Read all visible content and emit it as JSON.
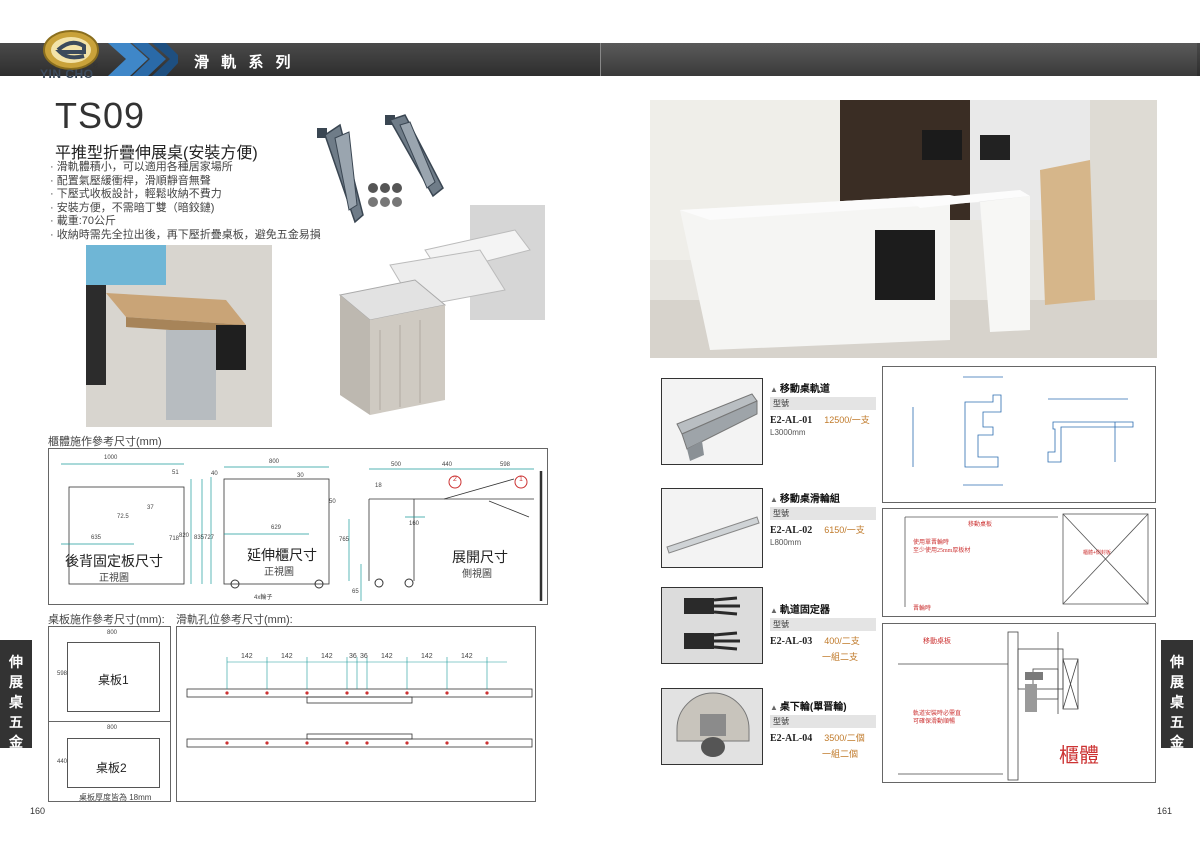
{
  "header": {
    "brand": "YIN CHO",
    "series": "滑 軌 系 列"
  },
  "product": {
    "model": "TS09",
    "title": "平推型折疊伸展桌(安裝方便)",
    "features": [
      "· 滑軌體積小，可以適用各種居家場所",
      "· 配置氣壓緩衝桿，滑順靜音無聲",
      "· 下壓式收板設計，輕鬆收納不費力",
      "· 安裝方便，不需暗丁雙（暗鉸鏈)",
      "· 載重:70公斤",
      "· 收納時需先全拉出後，再下壓折疊桌板，避免五金易損"
    ]
  },
  "sections": {
    "cabinet_dims": "櫃體施作參考尺寸(mm)",
    "board_dims": "桌板施作參考尺寸(mm):",
    "hole_dims": "滑軌孔位參考尺寸(mm):"
  },
  "drawing": {
    "back_board": "後背固定板尺寸",
    "back_view": "正視圖",
    "extend_cab": "延伸櫃尺寸",
    "extend_view": "正視圖",
    "unfold": "展開尺寸",
    "side_view": "側視圖",
    "dims": {
      "d1000": "1000",
      "d51": "51",
      "d37": "37",
      "d725": "72.5",
      "d635": "635",
      "d718": "718",
      "d820": "820",
      "d800": "800",
      "d30": "30",
      "d629": "629",
      "d40": "40",
      "d835": "835",
      "d727": "727",
      "d4x": "4x輪子",
      "d500": "500",
      "d440": "440",
      "d598": "598",
      "d18": "18",
      "d160": "160",
      "d765": "765",
      "d65": "65",
      "d50": "50",
      "c1": "1",
      "c2": "2"
    }
  },
  "boards": {
    "board1": "桌板1",
    "board2": "桌板2",
    "w1": "800",
    "h1": "598",
    "w2": "800",
    "h2": "440",
    "note": "桌板厚度皆為 18mm"
  },
  "holes": {
    "spacing": [
      "142",
      "142",
      "142",
      "36",
      "36",
      "142",
      "142",
      "142"
    ]
  },
  "side_tab": [
    "伸",
    "展",
    "桌",
    "五",
    "金"
  ],
  "pages": {
    "left": "160",
    "right": "161"
  },
  "parts": [
    {
      "name": "移動桌軌道",
      "label": "型號",
      "code": "E2-AL-01",
      "price": "12500/一支",
      "sub": "L3000mm",
      "subprice": ""
    },
    {
      "name": "移動桌滑輪組",
      "label": "型號",
      "code": "E2-AL-02",
      "price": "6150/一支",
      "sub": "L800mm",
      "subprice": ""
    },
    {
      "name": "軌道固定器",
      "label": "型號",
      "code": "E2-AL-03",
      "price": "400/二支",
      "sub": "",
      "subprice": "一組二支"
    },
    {
      "name": "桌下輪(單晋輪)",
      "label": "型號",
      "code": "E2-AL-04",
      "price": "3500/二個",
      "sub": "",
      "subprice": "一組二個"
    }
  ],
  "install": {
    "board_label": "移動桌板",
    "note1": "使用單晋輪時",
    "note2": "至少使用25mm厚板材",
    "right_label": "櫃體+側封板",
    "wheel": "晋輪時",
    "top_label": "移動桌板",
    "cabinet": "櫃體",
    "note3": "軌道安裝時必需直",
    "note4": "可確保滑動順暢"
  }
}
